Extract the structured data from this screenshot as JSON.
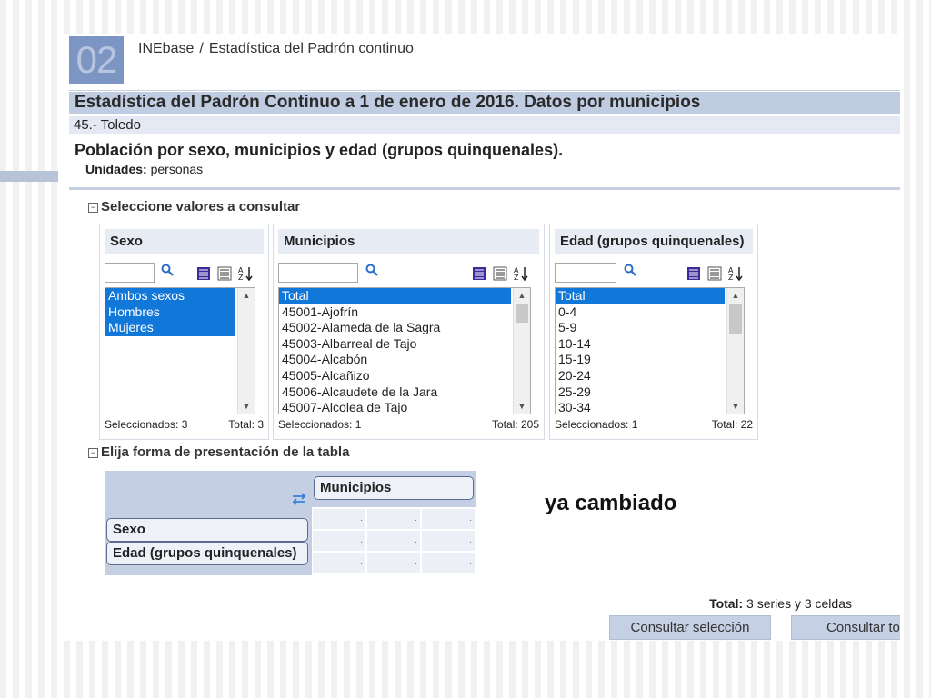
{
  "logo": {
    "text": "02"
  },
  "breadcrumb": {
    "root": "INEbase",
    "separator": "/",
    "current": "Estadística del Padrón continuo"
  },
  "title": "Estadística del Padrón Continuo a 1 de enero de 2016. Datos por municipios",
  "subtitle": "45.- Toledo",
  "table_title": "Población por sexo, municipios y edad (grupos quinquenales).",
  "units": {
    "label": "Unidades:",
    "value": "personas"
  },
  "select_section": {
    "toggle": "−",
    "label": "Seleccione valores a consultar"
  },
  "variables": [
    {
      "title": "Sexo",
      "search_value": "",
      "items": [
        {
          "label": "Ambos sexos",
          "selected": true
        },
        {
          "label": "Hombres",
          "selected": true
        },
        {
          "label": "Mujeres",
          "selected": true
        }
      ],
      "selected_label": "Seleccionados: 3",
      "total_label": "Total: 3"
    },
    {
      "title": "Municipios",
      "search_value": "",
      "items": [
        {
          "label": "Total",
          "selected": true
        },
        {
          "label": "45001-Ajofrín",
          "selected": false
        },
        {
          "label": "45002-Alameda de la Sagra",
          "selected": false
        },
        {
          "label": "45003-Albarreal de Tajo",
          "selected": false
        },
        {
          "label": "45004-Alcabón",
          "selected": false
        },
        {
          "label": "45005-Alcañizo",
          "selected": false
        },
        {
          "label": "45006-Alcaudete de la Jara",
          "selected": false
        },
        {
          "label": "45007-Alcolea de Tajo",
          "selected": false
        }
      ],
      "selected_label": "Seleccionados: 1",
      "total_label": "Total: 205"
    },
    {
      "title": "Edad (grupos quinquenales)",
      "search_value": "",
      "items": [
        {
          "label": "Total",
          "selected": true
        },
        {
          "label": "0-4",
          "selected": false
        },
        {
          "label": "5-9",
          "selected": false
        },
        {
          "label": "10-14",
          "selected": false
        },
        {
          "label": "15-19",
          "selected": false
        },
        {
          "label": "20-24",
          "selected": false
        },
        {
          "label": "25-29",
          "selected": false
        },
        {
          "label": "30-34",
          "selected": false
        }
      ],
      "selected_label": "Seleccionados: 1",
      "total_label": "Total: 22"
    }
  ],
  "layout_section": {
    "toggle": "−",
    "label": "Elija forma de presentación de la tabla"
  },
  "layout": {
    "column_vars": [
      "Municipios"
    ],
    "row_vars": [
      "Sexo",
      "Edad (grupos quinquenales)"
    ],
    "cell_placeholder": "."
  },
  "annotation": "ya cambiado",
  "summary": {
    "label": "Total:",
    "value": "3 series y 3 celdas"
  },
  "buttons": {
    "consult_selection": "Consultar selección",
    "consult_all": "Consultar toda la tabla"
  },
  "colors": {
    "selected": "#1177d9",
    "header_bg": "#c0cce2",
    "panel_header_bg": "#e6ebf4",
    "button_bg": "#c5d0e4"
  }
}
